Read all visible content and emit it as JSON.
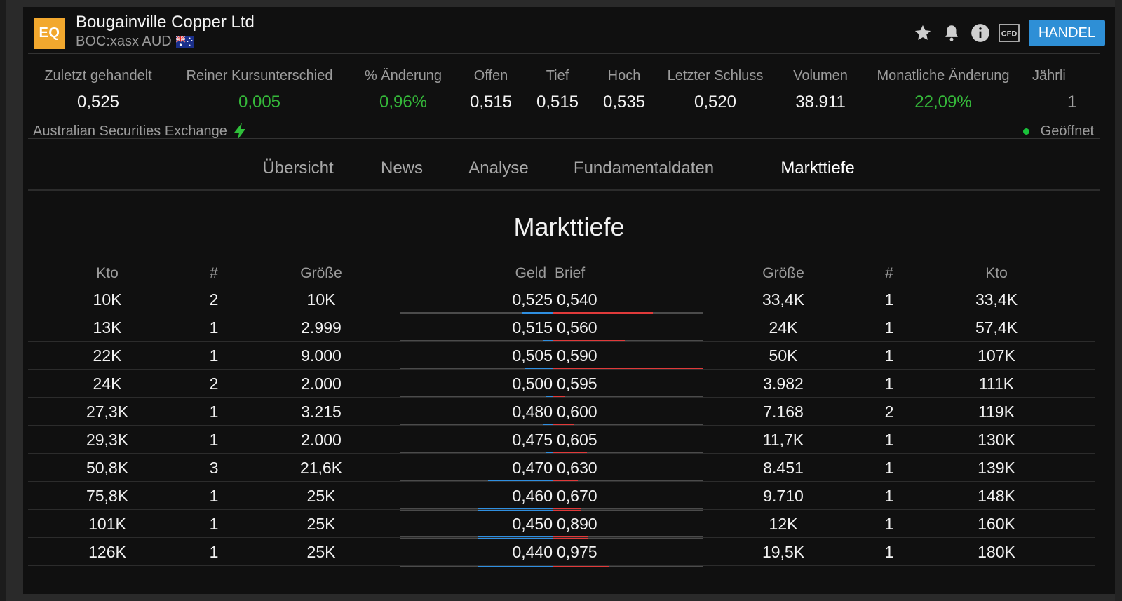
{
  "header": {
    "logo_text": "EQ",
    "company": "Bougainville Copper Ltd",
    "ticker": "BOC:xasx AUD",
    "trade_label": "HANDEL",
    "icons": [
      "star-icon",
      "bell-icon",
      "info-icon",
      "cfd-icon"
    ],
    "cfd_text": "CFD",
    "accent_color": "#2e8fd6"
  },
  "stats": [
    {
      "label": "Zuletzt gehandelt",
      "value": "0,525",
      "positive": false
    },
    {
      "label": "Reiner Kursunterschied",
      "value": "0,005",
      "positive": true
    },
    {
      "label": "% Änderung",
      "value": "0,96%",
      "positive": true
    },
    {
      "label": "Offen",
      "value": "0,515",
      "positive": false
    },
    {
      "label": "Tief",
      "value": "0,515",
      "positive": false
    },
    {
      "label": "Hoch",
      "value": "0,535",
      "positive": false
    },
    {
      "label": "Letzter Schluss",
      "value": "0,520",
      "positive": false
    },
    {
      "label": "Volumen",
      "value": "38.911",
      "positive": false
    },
    {
      "label": "Monatliche Änderung",
      "value": "22,09%",
      "positive": true
    },
    {
      "label": "Jährli",
      "value": "1",
      "positive": false
    }
  ],
  "exchange": {
    "name": "Australian Securities Exchange",
    "status": "Geöffnet"
  },
  "tabs": [
    {
      "label": "Übersicht",
      "active": false
    },
    {
      "label": "News",
      "active": false
    },
    {
      "label": "Analyse",
      "active": false
    },
    {
      "label": "Fundamentaldaten",
      "active": false
    },
    {
      "label": "Markttiefe",
      "active": true
    }
  ],
  "depth": {
    "title": "Markttiefe",
    "headers": {
      "kto_bid": "Kto",
      "count_bid": "#",
      "size_bid": "Größe",
      "bid": "Geld",
      "ask": "Brief",
      "size_ask": "Größe",
      "count_ask": "#",
      "kto_ask": "Kto"
    },
    "colors": {
      "bid_bar": "#2f8fe0",
      "ask_bar": "#e03a3a"
    },
    "rows": [
      {
        "kto_bid": "10K",
        "count_bid": "2",
        "size_bid": "10K",
        "bid": "0,525",
        "ask": "0,540",
        "size_ask": "33,4K",
        "count_ask": "1",
        "kto_ask": "33,4K",
        "bid_level": 0.2,
        "ask_level": 0.67
      },
      {
        "kto_bid": "13K",
        "count_bid": "1",
        "size_bid": "2.999",
        "bid": "0,515",
        "ask": "0,560",
        "size_ask": "24K",
        "count_ask": "1",
        "kto_ask": "57,4K",
        "bid_level": 0.06,
        "ask_level": 0.48
      },
      {
        "kto_bid": "22K",
        "count_bid": "1",
        "size_bid": "9.000",
        "bid": "0,505",
        "ask": "0,590",
        "size_ask": "50K",
        "count_ask": "1",
        "kto_ask": "107K",
        "bid_level": 0.18,
        "ask_level": 1.0
      },
      {
        "kto_bid": "24K",
        "count_bid": "2",
        "size_bid": "2.000",
        "bid": "0,500",
        "ask": "0,595",
        "size_ask": "3.982",
        "count_ask": "1",
        "kto_ask": "111K",
        "bid_level": 0.04,
        "ask_level": 0.08
      },
      {
        "kto_bid": "27,3K",
        "count_bid": "1",
        "size_bid": "3.215",
        "bid": "0,480",
        "ask": "0,600",
        "size_ask": "7.168",
        "count_ask": "2",
        "kto_ask": "119K",
        "bid_level": 0.06,
        "ask_level": 0.14
      },
      {
        "kto_bid": "29,3K",
        "count_bid": "1",
        "size_bid": "2.000",
        "bid": "0,475",
        "ask": "0,605",
        "size_ask": "11,7K",
        "count_ask": "1",
        "kto_ask": "130K",
        "bid_level": 0.04,
        "ask_level": 0.23
      },
      {
        "kto_bid": "50,8K",
        "count_bid": "3",
        "size_bid": "21,6K",
        "bid": "0,470",
        "ask": "0,630",
        "size_ask": "8.451",
        "count_ask": "1",
        "kto_ask": "139K",
        "bid_level": 0.43,
        "ask_level": 0.17
      },
      {
        "kto_bid": "75,8K",
        "count_bid": "1",
        "size_bid": "25K",
        "bid": "0,460",
        "ask": "0,670",
        "size_ask": "9.710",
        "count_ask": "1",
        "kto_ask": "148K",
        "bid_level": 0.5,
        "ask_level": 0.19
      },
      {
        "kto_bid": "101K",
        "count_bid": "1",
        "size_bid": "25K",
        "bid": "0,450",
        "ask": "0,890",
        "size_ask": "12K",
        "count_ask": "1",
        "kto_ask": "160K",
        "bid_level": 0.5,
        "ask_level": 0.24
      },
      {
        "kto_bid": "126K",
        "count_bid": "1",
        "size_bid": "25K",
        "bid": "0,440",
        "ask": "0,975",
        "size_ask": "19,5K",
        "count_ask": "1",
        "kto_ask": "180K",
        "bid_level": 0.5,
        "ask_level": 0.38
      }
    ]
  }
}
